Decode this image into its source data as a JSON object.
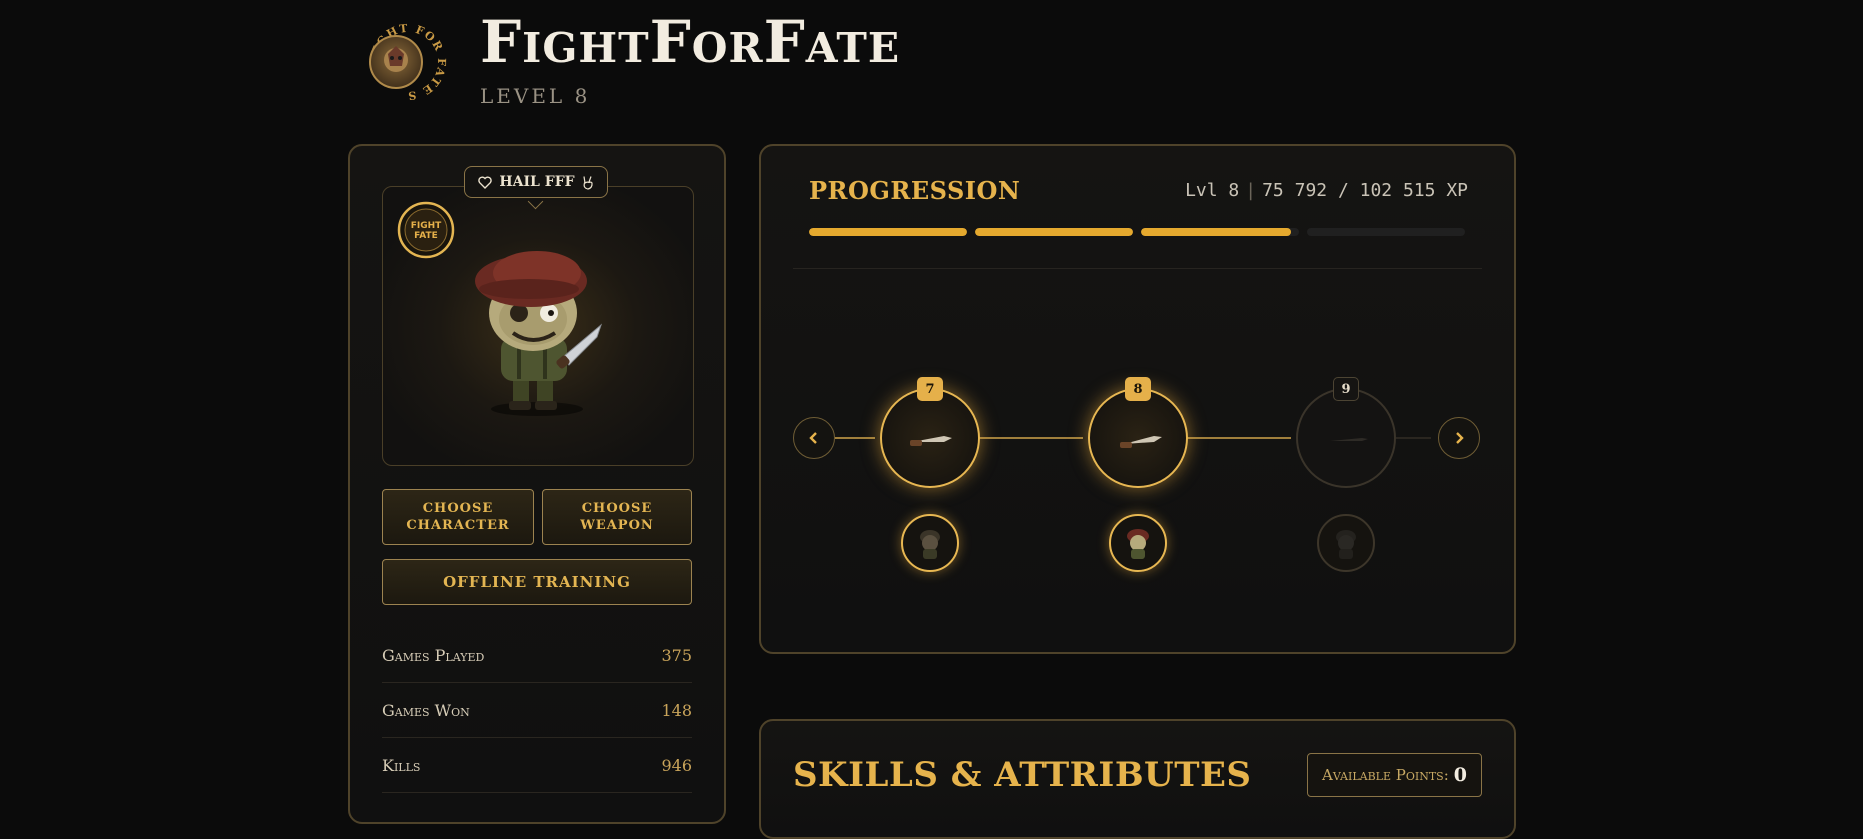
{
  "header": {
    "title": "FightForFate",
    "level": "LEVEL 8",
    "emblem_text": "FIGHT FOR FATE SQUAD"
  },
  "character_card": {
    "hail_label": "HAIL FFF",
    "logo_text": "FIGHT FOR FATE",
    "heart_icon": "heart-icon",
    "hand_icon": "peace-hand-icon"
  },
  "buttons": {
    "choose_character": "CHOOSE CHARACTER",
    "choose_weapon": "CHOOSE WEAPON",
    "offline_training": "OFFLINE TRAINING"
  },
  "stats": [
    {
      "label": "Games Played",
      "value": "375"
    },
    {
      "label": "Games Won",
      "value": "148"
    },
    {
      "label": "Kills",
      "value": "946"
    }
  ],
  "progression": {
    "title": "PROGRESSION",
    "level_text": "Lvl 8",
    "xp_text": "75 792 / 102 515 XP",
    "xp_current": 75792,
    "xp_max": 102515,
    "segments": [
      1,
      1,
      0.95,
      0
    ],
    "nodes": [
      {
        "level": "7",
        "unlocked": true
      },
      {
        "level": "8",
        "unlocked": true
      },
      {
        "level": "9",
        "unlocked": false
      }
    ],
    "prev_icon": "chevron-left-icon",
    "next_icon": "chevron-right-icon"
  },
  "skills": {
    "title": "SKILLS & ATTRIBUTES",
    "points_label": "Available Points:",
    "points_value": "0"
  },
  "colors": {
    "accent": "#e5a92e",
    "panel_border": "#4f432a",
    "background": "#0b0b0b"
  }
}
